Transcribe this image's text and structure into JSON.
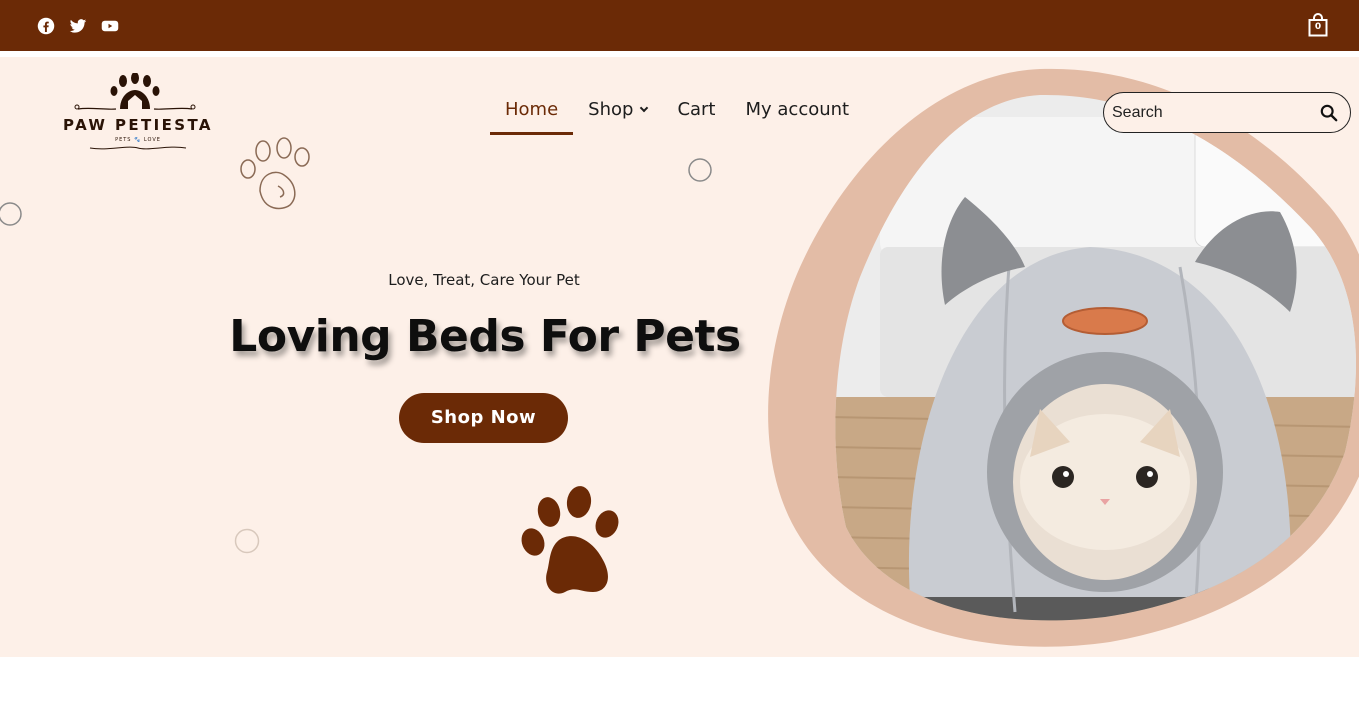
{
  "topbar": {
    "social_icons": [
      "facebook-icon",
      "twitter-icon",
      "youtube-icon"
    ],
    "cart_count": "0",
    "background_color": "#6b2a06"
  },
  "logo": {
    "title": "PAW PETIESTA",
    "tagline": "PETS 🐾 LOVE"
  },
  "nav": {
    "items": [
      {
        "label": "Home",
        "active": true
      },
      {
        "label": "Shop",
        "has_dropdown": true
      },
      {
        "label": "Cart"
      },
      {
        "label": "My account"
      }
    ],
    "active_color": "#6b2a06"
  },
  "search": {
    "placeholder": "Search",
    "icon": "search-icon"
  },
  "hero": {
    "subtitle": "Love, Treat, Care Your Pet",
    "headline": "Loving Beds For Pets",
    "cta_label": "Shop Now",
    "background_color": "#fdf0e8",
    "accent_color": "#6b2a06",
    "blob_color": "#e3bca6",
    "image": "cat-in-bed-image"
  }
}
